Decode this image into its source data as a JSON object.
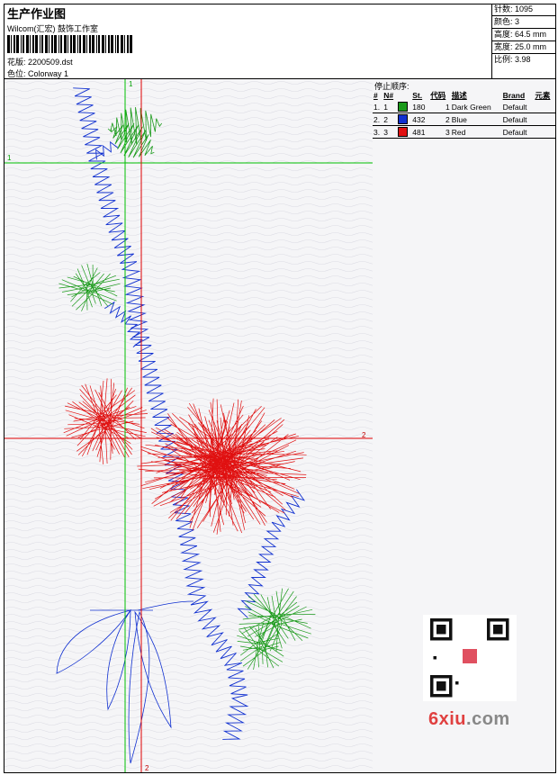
{
  "header": {
    "title": "生产作业图",
    "company": "Wilcom(汇宏) 鼓饰工作室",
    "file_label": "花版:",
    "file_value": "2200509.dst",
    "color_label": "色位:",
    "color_value": "Colorway 1"
  },
  "stats": [
    {
      "label": "针数:",
      "value": "1095"
    },
    {
      "label": "颜色:",
      "value": "3"
    },
    {
      "label": "高度:",
      "value": "64.5 mm"
    },
    {
      "label": "宽度:",
      "value": "25.0 mm"
    },
    {
      "label": "比例:",
      "value": "3.98"
    }
  ],
  "stop_sequence": {
    "title": "停止顺序:",
    "headers": [
      "#",
      "N#",
      "St.",
      "代码",
      "描述",
      "Brand",
      "元素"
    ],
    "rows": [
      {
        "idx": "1.",
        "n": "1",
        "st": "180",
        "code": "1",
        "desc": "Dark Green",
        "brand": "Default",
        "color": "#1a9a1a"
      },
      {
        "idx": "2.",
        "n": "2",
        "st": "432",
        "code": "2",
        "desc": "Blue",
        "brand": "Default",
        "color": "#1030d0"
      },
      {
        "idx": "3.",
        "n": "3",
        "st": "481",
        "code": "3",
        "desc": "Red",
        "brand": "Default",
        "color": "#e01010"
      }
    ]
  },
  "guides": {
    "h1": "1",
    "v1": "1",
    "h2": "2",
    "v2": "2"
  },
  "watermark": {
    "main": "6xiu",
    "suffix": ".com"
  },
  "colors": {
    "green": "#1a9a1a",
    "blue": "#1030d0",
    "red": "#e01010",
    "guide_green": "#00c000",
    "guide_red": "#e00000"
  }
}
